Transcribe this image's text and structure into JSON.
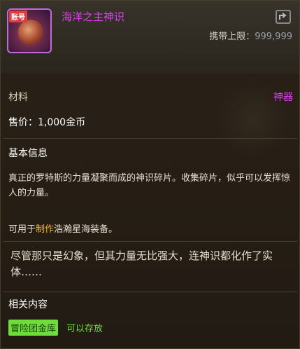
{
  "item": {
    "badge": "账号",
    "name": "海洋之主神识",
    "carry_label": "携带上限：",
    "carry_value": "999,999",
    "type": "材料",
    "rarity": "神器",
    "price": "售价：1,000金币"
  },
  "basic_info": {
    "title": "基本信息",
    "description": "真正的罗特斯的力量凝聚而成的神识碎片。收集碎片，似乎可以发挥惊人的力量。",
    "usage_prefix": "可用于",
    "usage_highlight": "制作",
    "usage_suffix": "浩瀚星海装备。",
    "flavor": "尽管那只是幻象，但其力量无比强大，连神识都化作了实体……"
  },
  "related": {
    "title": "相关内容",
    "tag": "冒险团金库",
    "text": "可以存放"
  },
  "colors": {
    "name": "#e040f0",
    "highlight": "#f0b830",
    "related": "#6fdc3a"
  },
  "icons": {
    "item": "octopus-icon",
    "share": "share-icon"
  }
}
